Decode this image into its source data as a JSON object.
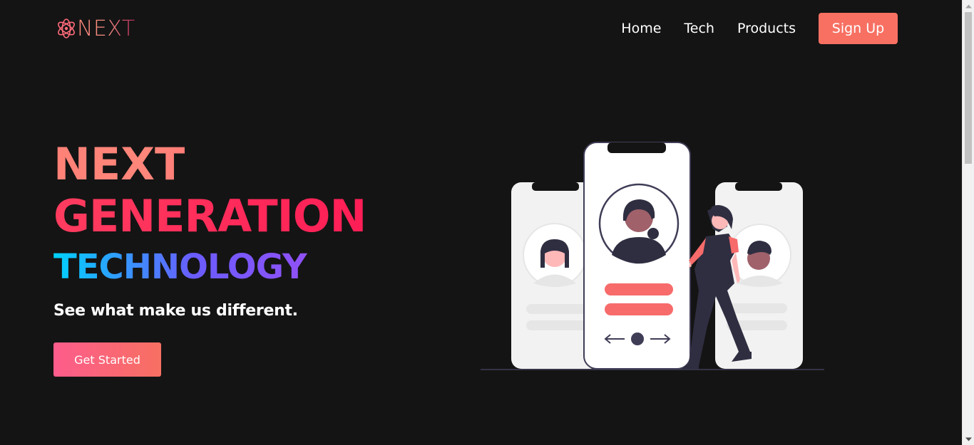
{
  "navbar": {
    "logo_text": "NEXT",
    "logo_icon": "atom-icon",
    "links": [
      {
        "label": "Home"
      },
      {
        "label": "Tech"
      },
      {
        "label": "Products"
      }
    ],
    "signup_label": "Sign Up"
  },
  "hero": {
    "line1": "NEXT",
    "line2": "GENERATION",
    "line3": "TECHNOLOGY",
    "tagline": "See what make us different.",
    "cta_label": "Get Started"
  },
  "illustration": {
    "description_icon": "phones-profile-illustration",
    "accent_color": "#f76b6b",
    "dark_color": "#3f3d56"
  },
  "colors": {
    "background": "#141414",
    "signup_button": "#f77062",
    "cta_gradient_start": "#fd5c8b",
    "cta_gradient_end": "#f77062"
  }
}
